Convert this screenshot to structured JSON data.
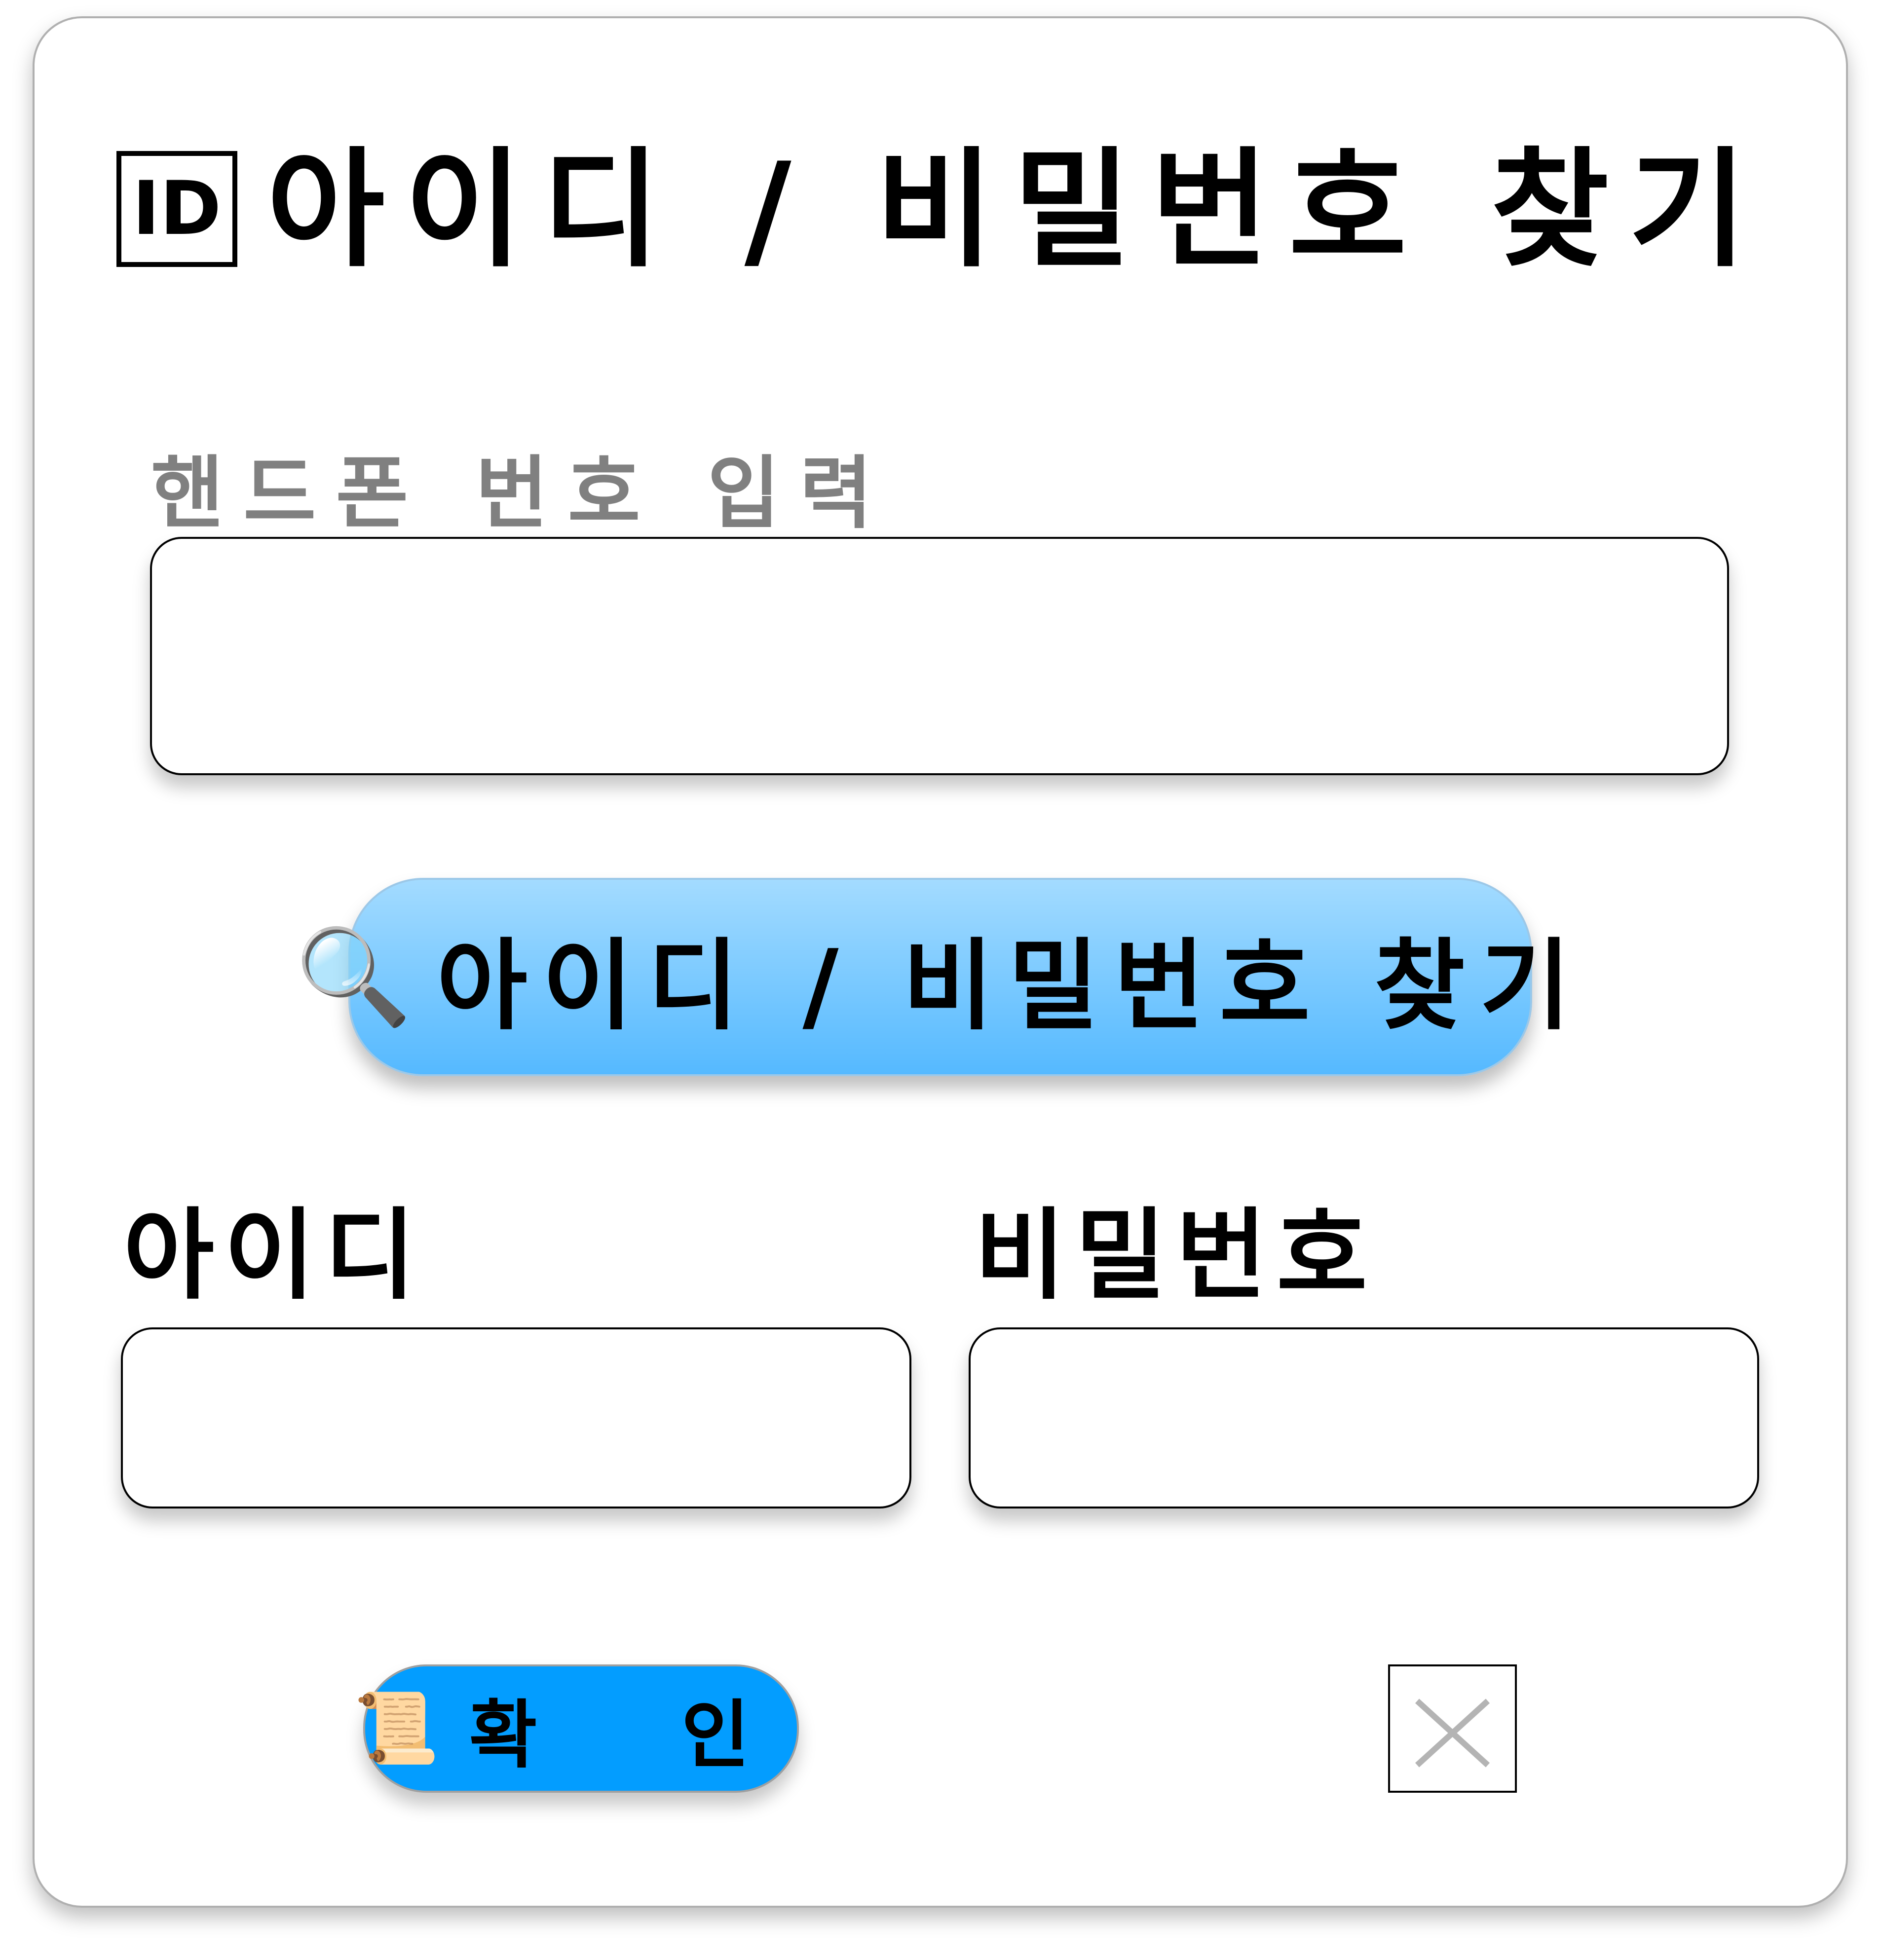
{
  "title": {
    "icon": "id-button-icon",
    "icon_text": "ID",
    "text": "아이디 / 비밀번호 찾기"
  },
  "phone": {
    "label": "핸드폰 번호 입력",
    "value": "",
    "placeholder": ""
  },
  "find_button": {
    "icon": "magnifying-glass-icon",
    "icon_glyph": "🔍",
    "label": "아이디 / 비밀번호 찾기",
    "gradient": [
      "#a3dbff",
      "#55b9ff"
    ]
  },
  "id_field": {
    "label": "아이디",
    "value": ""
  },
  "password_field": {
    "label": "비밀번호",
    "value": ""
  },
  "confirm_button": {
    "icon": "scroll-icon",
    "icon_glyph": "📜",
    "label": "확 인",
    "color": "#039dff"
  },
  "close_button": {
    "icon": "close-icon",
    "color": "#b4b4b4"
  }
}
